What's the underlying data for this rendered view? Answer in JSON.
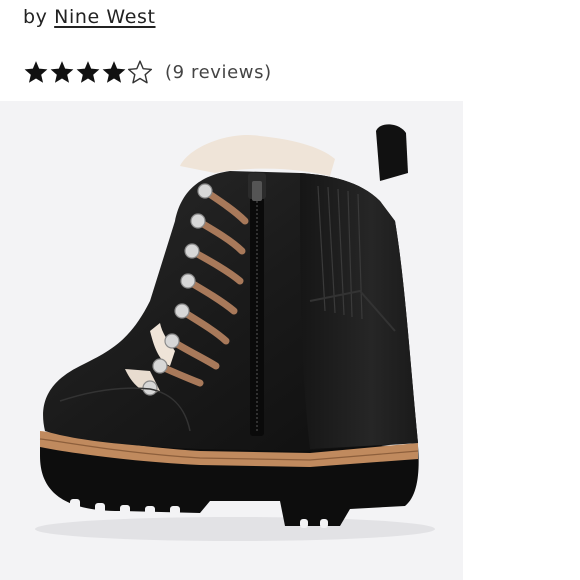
{
  "listing": {
    "byline_prefix": "by",
    "brand": "Nine West",
    "rating": {
      "value": 4,
      "max": 5,
      "reviews_label": "(9 reviews)",
      "filled_icon": "star-filled-icon",
      "empty_icon": "star-outline-icon"
    },
    "photo": {
      "icon": "product-photo-boot",
      "background_color": "#f3f3f5"
    }
  },
  "colors": {
    "text": "#222222",
    "star": "#111111",
    "lace": "#a8795a",
    "welt": "#c08a5e"
  }
}
